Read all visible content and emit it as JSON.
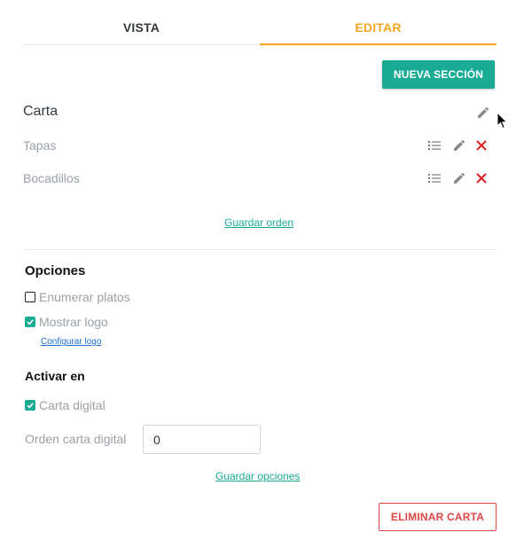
{
  "tabs": [
    {
      "label": "VISTA",
      "active": false
    },
    {
      "label": "EDITAR",
      "active": true
    }
  ],
  "toolbar": {
    "new_section_label": "NUEVA SECCIÓN"
  },
  "menu": {
    "title": "Carta",
    "sections": [
      {
        "label": "Tapas"
      },
      {
        "label": "Bocadillos"
      }
    ],
    "save_order_label": "Guardar orden"
  },
  "options": {
    "heading": "Opciones",
    "enumerate_dishes": {
      "label": "Enumerar platos",
      "checked": false
    },
    "show_logo": {
      "label": "Mostrar logo",
      "checked": true
    },
    "configure_logo_label": "Configurar logo"
  },
  "activate": {
    "heading": "Activar en",
    "digital_menu": {
      "label": "Carta digital",
      "checked": true
    },
    "order_label": "Orden carta digital",
    "order_value": "0",
    "save_options_label": "Guardar opciones"
  },
  "delete_label": "ELIMINAR CARTA",
  "colors": {
    "accent": "#1aab95",
    "active_tab": "#f5a623",
    "danger": "#e04545",
    "icon_gray": "#888888"
  },
  "icons": {
    "edit": "pencil-icon",
    "reorder": "list-icon",
    "delete": "close-icon",
    "check": "check-icon"
  }
}
